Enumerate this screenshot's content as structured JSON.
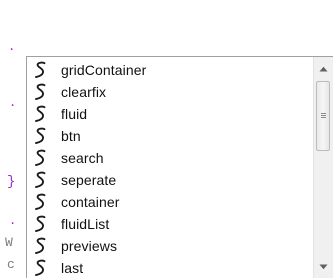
{
  "autocomplete": {
    "items": [
      {
        "icon": "snippet-icon",
        "label": "gridContainer"
      },
      {
        "icon": "snippet-icon",
        "label": "clearfix"
      },
      {
        "icon": "snippet-icon",
        "label": "fluid"
      },
      {
        "icon": "snippet-icon",
        "label": "btn"
      },
      {
        "icon": "snippet-icon",
        "label": "search"
      },
      {
        "icon": "snippet-icon",
        "label": "seperate"
      },
      {
        "icon": "snippet-icon",
        "label": "container"
      },
      {
        "icon": "snippet-icon",
        "label": "fluidList"
      },
      {
        "icon": "snippet-icon",
        "label": "previews"
      },
      {
        "icon": "snippet-icon",
        "label": "last"
      }
    ],
    "scroll": {
      "visible_fraction": 0.4,
      "position_fraction": 0.0
    },
    "colors": {
      "icon": "#1a1a1a",
      "text": "#111111",
      "border": "#a0a0a0",
      "scrollbar_track": "#f0f0f0"
    }
  },
  "editor_gutter": {
    "marks": [
      ".",
      ".",
      "}",
      ".",
      "W",
      "c"
    ]
  }
}
